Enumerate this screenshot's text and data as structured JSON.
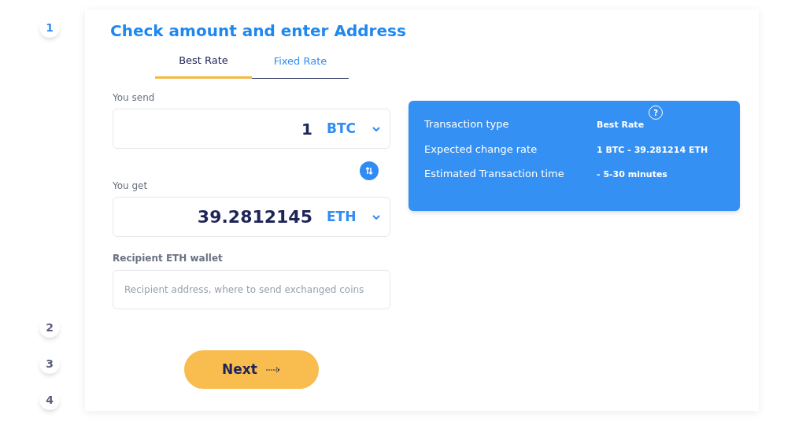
{
  "steps": [
    {
      "label": "1",
      "active": true
    },
    {
      "label": "2",
      "active": false
    },
    {
      "label": "3",
      "active": false
    },
    {
      "label": "4",
      "active": false
    }
  ],
  "title": "Check amount and enter Address",
  "tabs": [
    {
      "label": "Best Rate",
      "selected": true
    },
    {
      "label": "Fixed Rate",
      "selected": false
    }
  ],
  "send": {
    "label": "You send",
    "value": "1",
    "currency": "BTC"
  },
  "get": {
    "label": "You get",
    "value": "39.2812145",
    "currency": "ETH"
  },
  "wallet": {
    "label": "Recipient ETH wallet",
    "placeholder": "Recipient address, where to send exchanged coins"
  },
  "next_button": "Next",
  "info": [
    {
      "label": "Transaction type",
      "value": "Best Rate",
      "help": "?"
    },
    {
      "label": "Expected change rate",
      "value": "1 BTC - 39.281214 ETH"
    },
    {
      "label": "Estimated Transaction time",
      "value": "- 5-30 minutes"
    }
  ]
}
